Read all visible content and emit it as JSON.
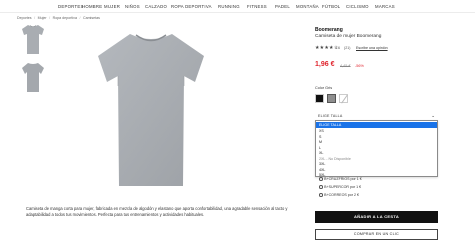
{
  "nav": {
    "items": [
      "DEPORTES",
      "HOMBRE",
      "MUJER",
      "NIÑOS",
      "CALZADO",
      "ROPA DEPORTIVA",
      "RUNNING",
      "FITNESS",
      "PADEL",
      "MONTAÑA",
      "FÚTBOL",
      "CICLISMO",
      "MARCAS"
    ]
  },
  "breadcrumb": [
    "Deportes",
    "Mujer",
    "Ropa deportiva",
    "Camisetas"
  ],
  "product": {
    "brand": "Boomerang",
    "name": "Camiseta de mujer Boomerang",
    "stars": "★★★★☆",
    "rating": "4.6",
    "review_count": "(21)",
    "write_review": "Escribe una opinión",
    "price": "1,96 €",
    "old_price": "4,45 €",
    "discount": "-56%",
    "color_label": "Color Gris",
    "description": "Camiseta de manga corta para mujer, fabricada en mezcla de algodón y elastano que aporta confortabilidad, una agradable sensación al tacto y adaptabilidad a todos tus movimientos. Perfecta para tus entrenamientos y actividades habituales.",
    "colors": [
      "#111111",
      "#8e8e8e",
      "#ffffff"
    ]
  },
  "size_select": {
    "label": "ELIGE TALLA",
    "chevron_icon": "chevron-down-icon",
    "options": [
      {
        "label": "ELIGE TALLA",
        "selected": true,
        "disabled": false
      },
      {
        "label": "XS",
        "selected": false,
        "disabled": false
      },
      {
        "label": "S",
        "selected": false,
        "disabled": false
      },
      {
        "label": "M",
        "selected": false,
        "disabled": false
      },
      {
        "label": "L",
        "selected": false,
        "disabled": false
      },
      {
        "label": "XL",
        "selected": false,
        "disabled": false
      },
      {
        "label": "2XL - No Disponible",
        "selected": false,
        "disabled": true
      },
      {
        "label": "3XL",
        "selected": false,
        "disabled": false
      },
      {
        "label": "4XL",
        "selected": false,
        "disabled": false
      },
      {
        "label": "5XL",
        "selected": false,
        "disabled": false
      }
    ]
  },
  "shipping": [
    "B+CRUZFRIOS por 1 €",
    "B+SUPERCOR por 1 €",
    "B+CORREOS por 2 €"
  ],
  "actions": {
    "add_to_cart": "AÑADIR A LA CESTA",
    "buy_one_click": "COMPRAR EN UN CLIC"
  },
  "accent": {
    "price_red": "#e0242d",
    "select_blue": "#1a73e8"
  }
}
